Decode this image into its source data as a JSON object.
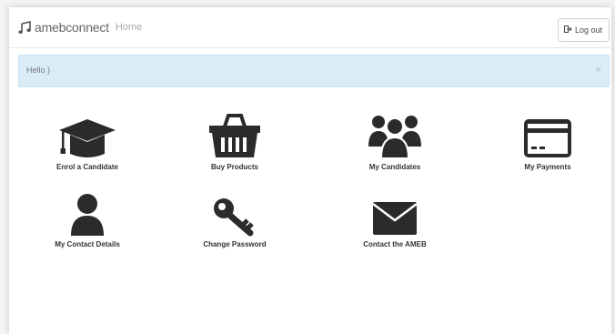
{
  "header": {
    "brand": "amebconnect",
    "home_link": "Home",
    "logout_label": "Log out"
  },
  "alert": {
    "message": "Hello )",
    "close": "×"
  },
  "tiles": [
    {
      "label": "Enrol a Candidate",
      "icon": "graduation-cap-icon"
    },
    {
      "label": "Buy Products",
      "icon": "shopping-basket-icon"
    },
    {
      "label": "My Candidates",
      "icon": "users-icon"
    },
    {
      "label": "My Payments",
      "icon": "credit-card-icon"
    },
    {
      "label": "My Contact Details",
      "icon": "user-icon"
    },
    {
      "label": "Change Password",
      "icon": "key-icon"
    },
    {
      "label": "Contact the AMEB",
      "icon": "envelope-icon"
    }
  ],
  "colors": {
    "alert_bg": "#d9edf7",
    "icon": "#2b2b2b"
  }
}
